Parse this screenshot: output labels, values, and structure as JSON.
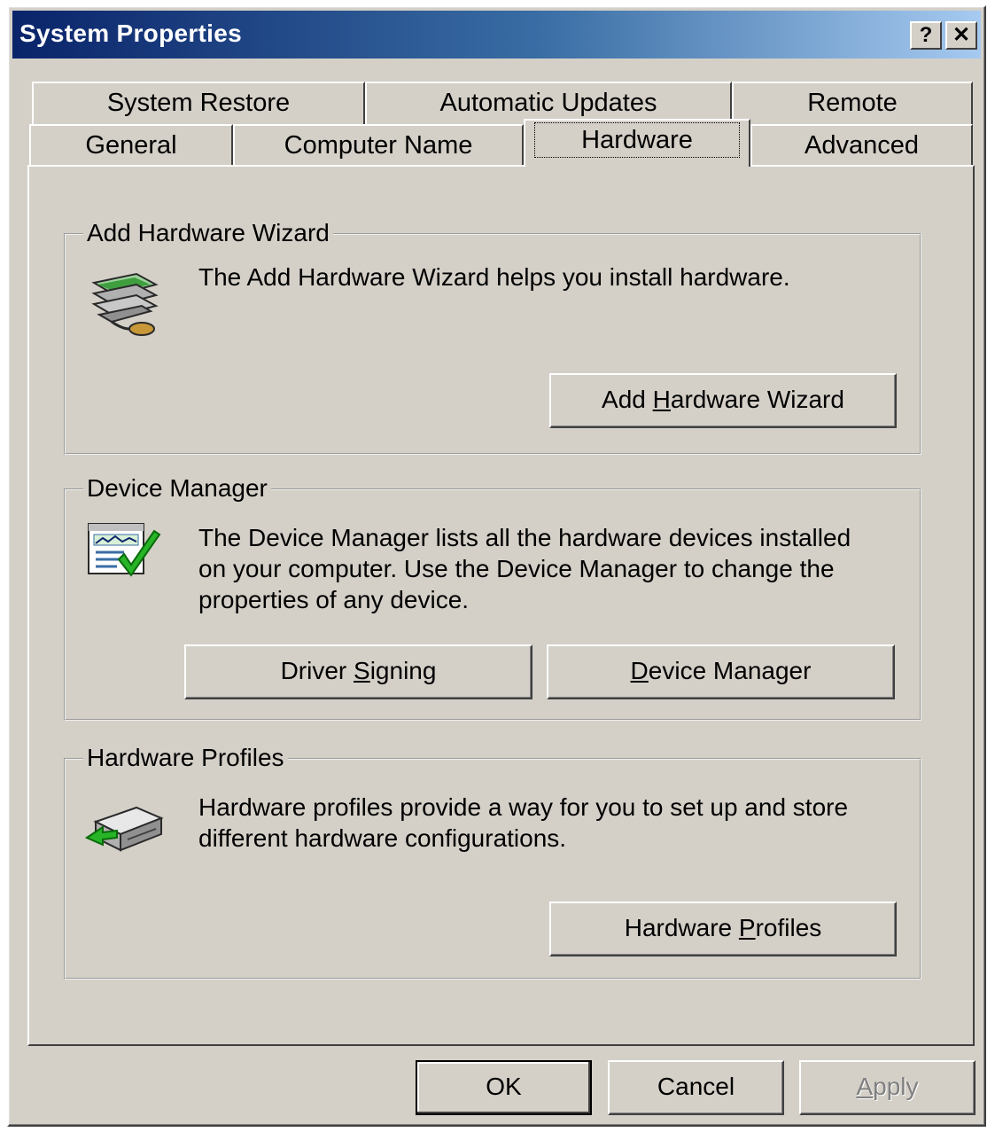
{
  "window": {
    "title": "System Properties",
    "help_label": "?",
    "close_label": "✕"
  },
  "tabs": {
    "row_back": [
      "System Restore",
      "Automatic Updates",
      "Remote"
    ],
    "row_front": [
      "General",
      "Computer Name",
      "Hardware",
      "Advanced"
    ],
    "selected": "Hardware"
  },
  "add_hardware": {
    "legend": "Add Hardware Wizard",
    "description": "The Add Hardware Wizard helps you install hardware.",
    "button_pre": "Add ",
    "button_mnemonic": "H",
    "button_post": "ardware Wizard",
    "icon": "hardware-wizard-icon"
  },
  "device_manager": {
    "legend": "Device Manager",
    "description_lines": [
      "The Device Manager lists all the hardware devices installed",
      "on your computer. Use the Device Manager to change the",
      "properties of any device."
    ],
    "driver_signing_pre": "Driver ",
    "driver_signing_mnemonic": "S",
    "driver_signing_post": "igning",
    "device_manager_mnemonic": "D",
    "device_manager_post": "evice Manager",
    "icon": "device-manager-icon"
  },
  "hardware_profiles": {
    "legend": "Hardware Profiles",
    "description_lines": [
      "Hardware profiles provide a way for you to set up and store",
      "different hardware configurations."
    ],
    "button_pre": "Hardware ",
    "button_mnemonic": "P",
    "button_post": "rofiles",
    "icon": "hardware-profiles-icon"
  },
  "footer": {
    "ok_label": "OK",
    "cancel_label": "Cancel",
    "apply_mnemonic": "A",
    "apply_post": "pply"
  }
}
